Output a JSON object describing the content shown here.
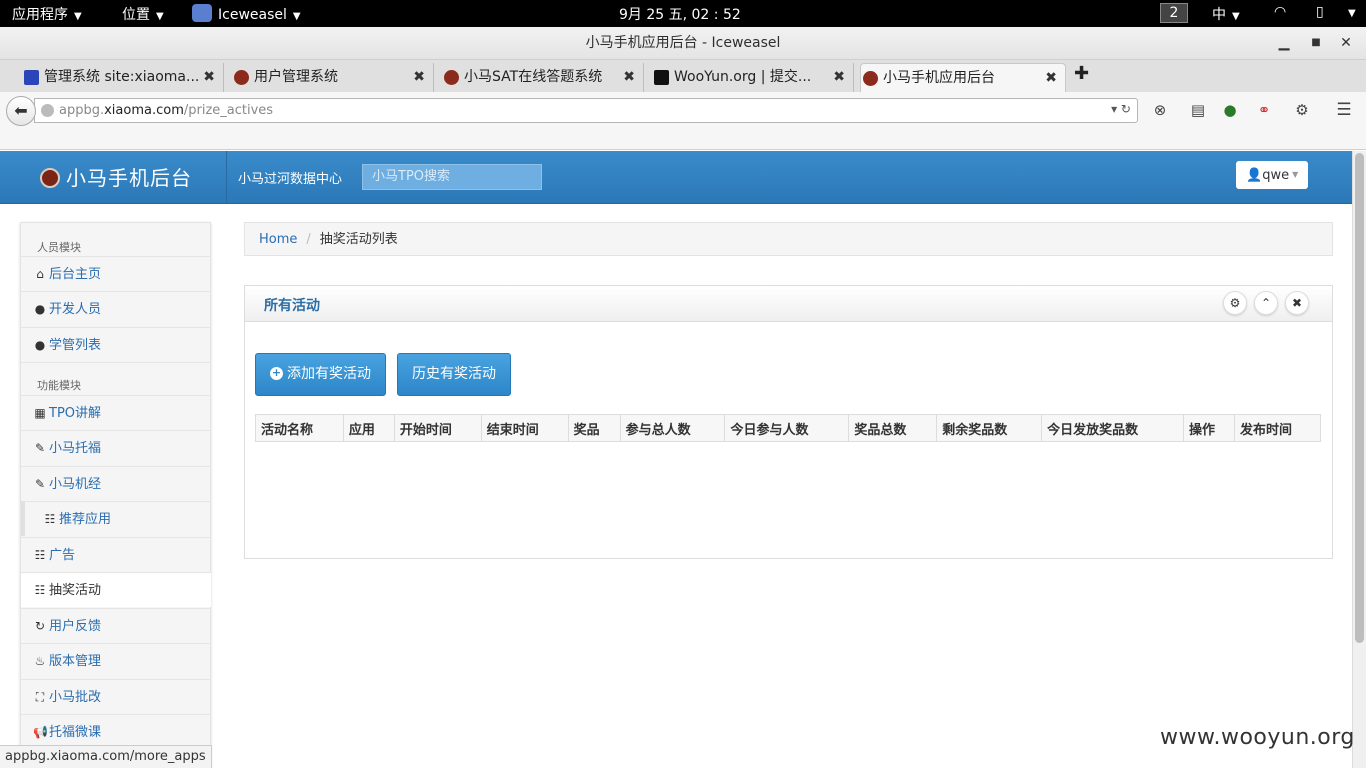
{
  "topbar": {
    "apps_menu": "应用程序",
    "places_menu": "位置",
    "active_app": "Iceweasel",
    "clock": "9月 25 五, 02 : 52",
    "workspace": "2",
    "input_method": "中"
  },
  "window": {
    "title": "小马手机应用后台 - Iceweasel"
  },
  "tabs": [
    {
      "label": "管理系统 site:xiaoma..."
    },
    {
      "label": "用户管理系统"
    },
    {
      "label": "小马SAT在线答题系统"
    },
    {
      "label": "WooYun.org | 提交..."
    },
    {
      "label": "小马手机应用后台"
    }
  ],
  "navbar": {
    "url_host": "appbg.xiaoma.com",
    "url_prefix": "appbg.",
    "url_domain": "xiaoma.com",
    "url_path": "/prize_actives"
  },
  "header": {
    "brand": "小马手机后台",
    "data_center": "小马过河数据中心",
    "search_placeholder": "小马TPO搜索",
    "user": "qwe"
  },
  "sidebar": {
    "section1": "人员模块",
    "section2": "功能模块",
    "items": [
      {
        "label": "后台主页",
        "icon": "home-icon"
      },
      {
        "label": "开发人员",
        "icon": "user-icon"
      },
      {
        "label": "学管列表",
        "icon": "user-icon"
      },
      {
        "label": "TPO讲解",
        "icon": "film-icon"
      },
      {
        "label": "小马托福",
        "icon": "edit-icon"
      },
      {
        "label": "小马机经",
        "icon": "edit-icon"
      },
      {
        "label": "推荐应用",
        "icon": "list-icon"
      },
      {
        "label": "广告",
        "icon": "list-icon"
      },
      {
        "label": "抽奖活动",
        "icon": "list-icon"
      },
      {
        "label": "用户反馈",
        "icon": "refresh-icon"
      },
      {
        "label": "版本管理",
        "icon": "fire-icon"
      },
      {
        "label": "小马批改",
        "icon": "fullscreen-icon"
      },
      {
        "label": "托福微课",
        "icon": "bullhorn-icon"
      }
    ]
  },
  "breadcrumb": {
    "home": "Home",
    "separator": "/",
    "current": "抽奖活动列表"
  },
  "panel": {
    "title": "所有活动",
    "add_button": "添加有奖活动",
    "history_button": "历史有奖活动",
    "columns": [
      "活动名称",
      "应用",
      "开始时间",
      "结束时间",
      "奖品",
      "参与总人数",
      "今日参与人数",
      "奖品总数",
      "剩余奖品数",
      "今日发放奖品数",
      "操作",
      "发布时间"
    ]
  },
  "statusbar": {
    "text": "appbg.xiaoma.com/more_apps"
  },
  "watermark": "www.wooyun.org",
  "colors": {
    "header_blue": "#2b78b7",
    "link_blue": "#2a6db0",
    "button_blue": "#2c86c8"
  }
}
